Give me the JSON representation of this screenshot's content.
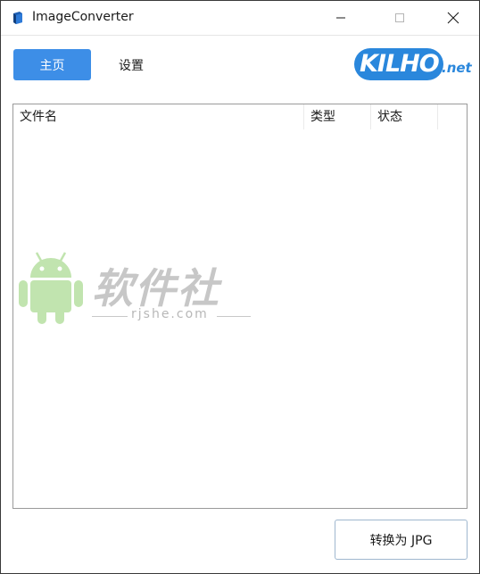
{
  "window": {
    "title": "ImageConverter",
    "controls": [
      "minimize-icon",
      "maximize-icon",
      "close-icon"
    ]
  },
  "toolbar": {
    "tabs": [
      {
        "label": "主页",
        "active": true
      },
      {
        "label": "设置",
        "active": false
      }
    ]
  },
  "logo": {
    "main": "KILHO",
    "suffix": ".net"
  },
  "file_list": {
    "columns": [
      "文件名",
      "类型",
      "状态"
    ],
    "rows": []
  },
  "watermark": {
    "text": "软件社",
    "url": "rjshe.com"
  },
  "actions": {
    "convert_label": "转换为 JPG"
  },
  "colors": {
    "accent": "#3d8ee7",
    "logo_blue": "#2a87dc",
    "list_border": "#9a9a9a"
  }
}
